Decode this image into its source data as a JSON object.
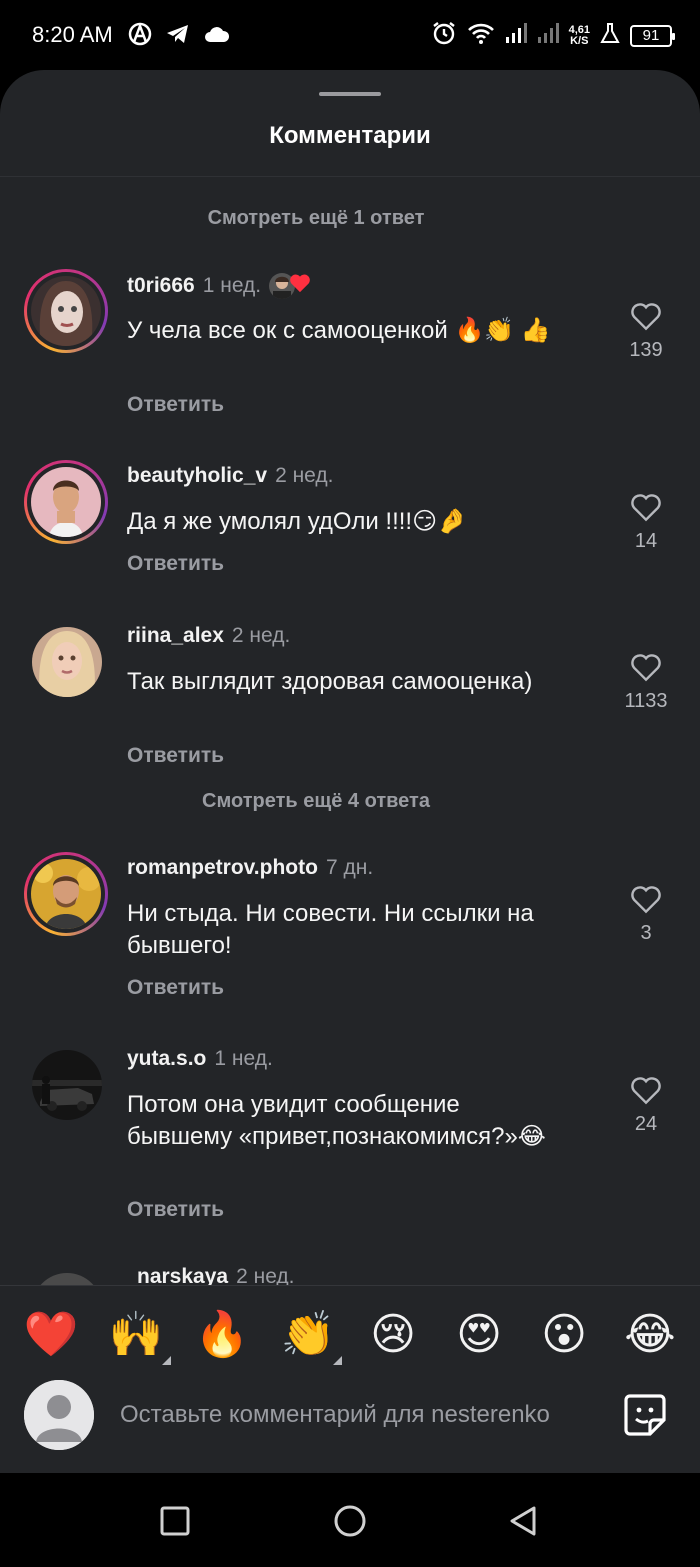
{
  "status_bar": {
    "time": "8:20 AM",
    "net_speed_value": "4,61",
    "net_speed_unit": "K/S",
    "battery": "91",
    "icons": [
      "vpn-a-icon",
      "telegram-icon",
      "cloud-icon",
      "alarm-icon",
      "wifi-icon",
      "signal-icon",
      "signal-icon",
      "lab-flask-icon",
      "battery-icon"
    ]
  },
  "sheet": {
    "title": "Комментарии"
  },
  "more_replies": [
    "Смотреть ещё 1 ответ",
    "Смотреть ещё 4 ответа"
  ],
  "comments": [
    {
      "username": "t0ri666",
      "time": "1 нед.",
      "liked_by_author": true,
      "text": "У чела все ок с самооценкой 🔥👏 👍",
      "reply_label": "Ответить",
      "likes": "139",
      "story_ring": true
    },
    {
      "username": "beautyholic_v",
      "time": "2 нед.",
      "liked_by_author": false,
      "text": "Да я же умолял удОли !!!!😏🤌",
      "reply_label": "Ответить",
      "likes": "14",
      "story_ring": true
    },
    {
      "username": "riina_alex",
      "time": "2 нед.",
      "liked_by_author": false,
      "text": "Так выглядит здоровая самооценка)",
      "reply_label": "Ответить",
      "likes": "1133",
      "story_ring": false
    },
    {
      "username": "romanpetrov.photo",
      "time": "7 дн.",
      "liked_by_author": false,
      "text": "Ни стыда. Ни совести. Ни ссылки на бывшего!",
      "reply_label": "Ответить",
      "likes": "3",
      "story_ring": true
    },
    {
      "username": "yuta.s.o",
      "time": "1 нед.",
      "liked_by_author": false,
      "text": "Потом она увидит сообщение бывшему «привет,познакомимся?»😂",
      "reply_label": "Ответить",
      "likes": "24",
      "story_ring": false
    },
    {
      "username": "narskaya",
      "time": "2 нед.",
      "partial": true
    }
  ],
  "reactions": [
    "❤️",
    "🙌",
    "🔥",
    "👏",
    "😢",
    "😍",
    "😮",
    "😂"
  ],
  "comment_input": {
    "placeholder": "Оставьте комментарий для nesterenko"
  },
  "nav": {
    "icons": [
      "recents-square-icon",
      "home-circle-icon",
      "back-triangle-icon"
    ]
  },
  "colors": {
    "sheet_bg": "#232528",
    "secondary_text": "#9a9ca2",
    "like_heart": "#ff3040"
  }
}
